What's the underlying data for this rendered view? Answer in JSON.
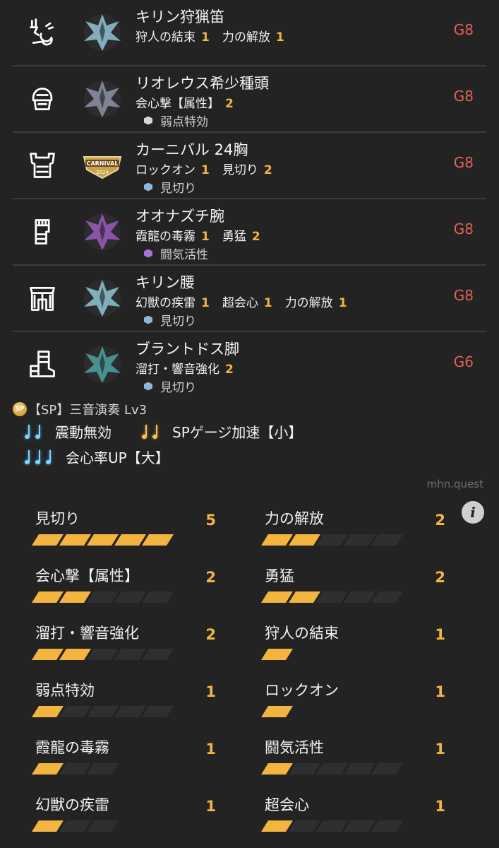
{
  "equipment": [
    {
      "slot_icon": "weapon-horn-icon",
      "monster_icon": "kirin-icon",
      "monster_color": "#8fc6d6",
      "name": "キリン狩猟笛",
      "skills": [
        {
          "name": "狩人の結束",
          "level": "1"
        },
        {
          "name": "力の解放",
          "level": "1"
        }
      ],
      "deco": null,
      "grade": "G8"
    },
    {
      "slot_icon": "head-armor-icon",
      "monster_icon": "rathalos-icon",
      "monster_color": "#8d93a8",
      "name": "リオレウス希少種頭",
      "skills": [
        {
          "name": "会心撃【属性】",
          "level": "2"
        }
      ],
      "deco": {
        "name": "弱点特効",
        "color": "#d8d8d8"
      },
      "grade": "G8"
    },
    {
      "slot_icon": "chest-armor-icon",
      "monster_icon": "carnival-icon",
      "monster_color": "#c9a24a",
      "name": "カーニバル 24胸",
      "skills": [
        {
          "name": "ロックオン",
          "level": "1"
        },
        {
          "name": "見切り",
          "level": "2"
        }
      ],
      "deco": {
        "name": "見切り",
        "color": "#8fb8d8"
      },
      "grade": "G8"
    },
    {
      "slot_icon": "arm-armor-icon",
      "monster_icon": "chameleos-icon",
      "monster_color": "#9a5cc0",
      "name": "オオナズチ腕",
      "skills": [
        {
          "name": "霞龍の毒霧",
          "level": "1"
        },
        {
          "name": "勇猛",
          "level": "2"
        }
      ],
      "deco": {
        "name": "闘気活性",
        "color": "#a674d4"
      },
      "grade": "G8"
    },
    {
      "slot_icon": "waist-armor-icon",
      "monster_icon": "kirin-icon",
      "monster_color": "#8fc6d6",
      "name": "キリン腰",
      "skills": [
        {
          "name": "幻獣の疾雷",
          "level": "1"
        },
        {
          "name": "超会心",
          "level": "1"
        },
        {
          "name": "力の解放",
          "level": "1"
        }
      ],
      "deco": {
        "name": "見切り",
        "color": "#8fb8d8"
      },
      "grade": "G8"
    },
    {
      "slot_icon": "leg-armor-icon",
      "monster_icon": "brachydios-icon",
      "monster_color": "#4fa3a0",
      "name": "ブラントドス脚",
      "skills": [
        {
          "name": "溜打・響音強化",
          "level": "2"
        }
      ],
      "deco": {
        "name": "見切り",
        "color": "#8fb8d8"
      },
      "grade": "G6"
    }
  ],
  "sp": {
    "badge": "SP",
    "title": "【SP】三音演奏 Lv3",
    "effects": [
      {
        "notes": [
          "blue",
          "blue"
        ],
        "label": "震動無効"
      },
      {
        "notes": [
          "gold",
          "gold"
        ],
        "label": "SPゲージ加速【小】"
      },
      {
        "notes": [
          "blue",
          "blue",
          "blue"
        ],
        "label": "会心率UP【大】"
      }
    ]
  },
  "site": "mhn.quest",
  "info_label": "i",
  "summary": [
    {
      "name": "見切り",
      "level": "5",
      "max": 5
    },
    {
      "name": "力の解放",
      "level": "2",
      "max": 5
    },
    {
      "name": "会心撃【属性】",
      "level": "2",
      "max": 5
    },
    {
      "name": "勇猛",
      "level": "2",
      "max": 5
    },
    {
      "name": "溜打・響音強化",
      "level": "2",
      "max": 5
    },
    {
      "name": "狩人の結束",
      "level": "1",
      "max": 1
    },
    {
      "name": "弱点特効",
      "level": "1",
      "max": 5
    },
    {
      "name": "ロックオン",
      "level": "1",
      "max": 1
    },
    {
      "name": "霞龍の毒霧",
      "level": "1",
      "max": 3
    },
    {
      "name": "闘気活性",
      "level": "1",
      "max": 5
    },
    {
      "name": "幻獣の疾雷",
      "level": "1",
      "max": 3
    },
    {
      "name": "超会心",
      "level": "1",
      "max": 5
    }
  ],
  "colors": {
    "accent": "#f3b53f",
    "grade": "#e36055",
    "background": "#232323"
  }
}
